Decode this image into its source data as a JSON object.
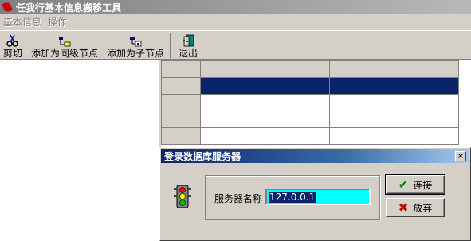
{
  "window": {
    "title": "任我行基本信息搬移工具"
  },
  "menu": {
    "items": [
      "基本信息",
      "操作"
    ]
  },
  "toolbar": {
    "cut": "剪切",
    "add_sibling": "添加为同级节点",
    "add_child": "添加为子节点",
    "exit": "退出"
  },
  "grid": {
    "columns": 5,
    "rows": 5,
    "selected_row": 1
  },
  "dialog": {
    "title": "登录数据库服务器",
    "close": "×",
    "server_label": "服务器名称",
    "server_value": "127.0.0.1",
    "connect": "连接",
    "cancel": "放弃"
  }
}
